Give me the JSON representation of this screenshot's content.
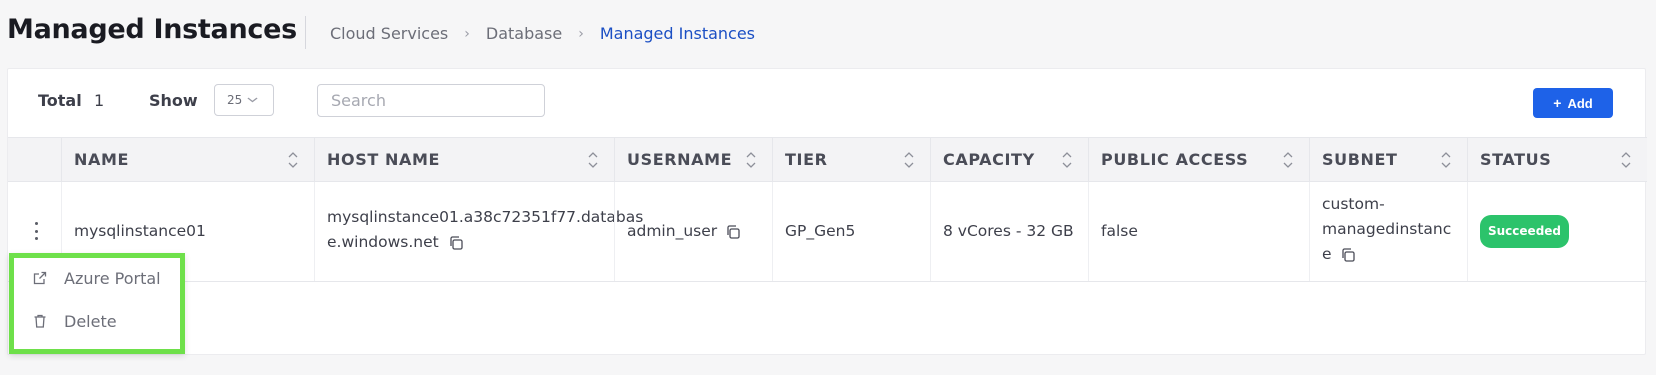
{
  "header": {
    "title": "Managed Instances",
    "breadcrumb": [
      "Cloud Services",
      "Database",
      "Managed Instances"
    ],
    "breadcrumb_separator": "›"
  },
  "toolbar": {
    "total_label": "Total",
    "total_value": "1",
    "show_label": "Show",
    "show_value": "25",
    "search_placeholder": "Search",
    "add_label": "Add"
  },
  "table": {
    "columns": [
      "NAME",
      "HOST NAME",
      "USERNAME",
      "TIER",
      "CAPACITY",
      "PUBLIC ACCESS",
      "SUBNET",
      "STATUS"
    ],
    "rows": [
      {
        "name": "mysqlinstance01",
        "host_name_line1": "mysqlinstance01.a38c72351f77.databas",
        "host_name_line2": "e.windows.net",
        "username": "admin_user",
        "tier": "GP_Gen5",
        "capacity": "8 vCores - 32 GB",
        "public_access": "false",
        "subnet_line1": "custom-",
        "subnet_line2": "managedinstanc",
        "subnet_line3": "e",
        "status": "Succeeded"
      }
    ]
  },
  "row_menu": {
    "items": [
      {
        "label": "Azure Portal",
        "icon": "external-link-icon"
      },
      {
        "label": "Delete",
        "icon": "trash-icon"
      }
    ]
  },
  "colors": {
    "accent": "#1e62e8",
    "breadcrumb_active": "#1b4fc4",
    "status_success": "#2cc36b",
    "highlight_border": "#6ee04a"
  }
}
